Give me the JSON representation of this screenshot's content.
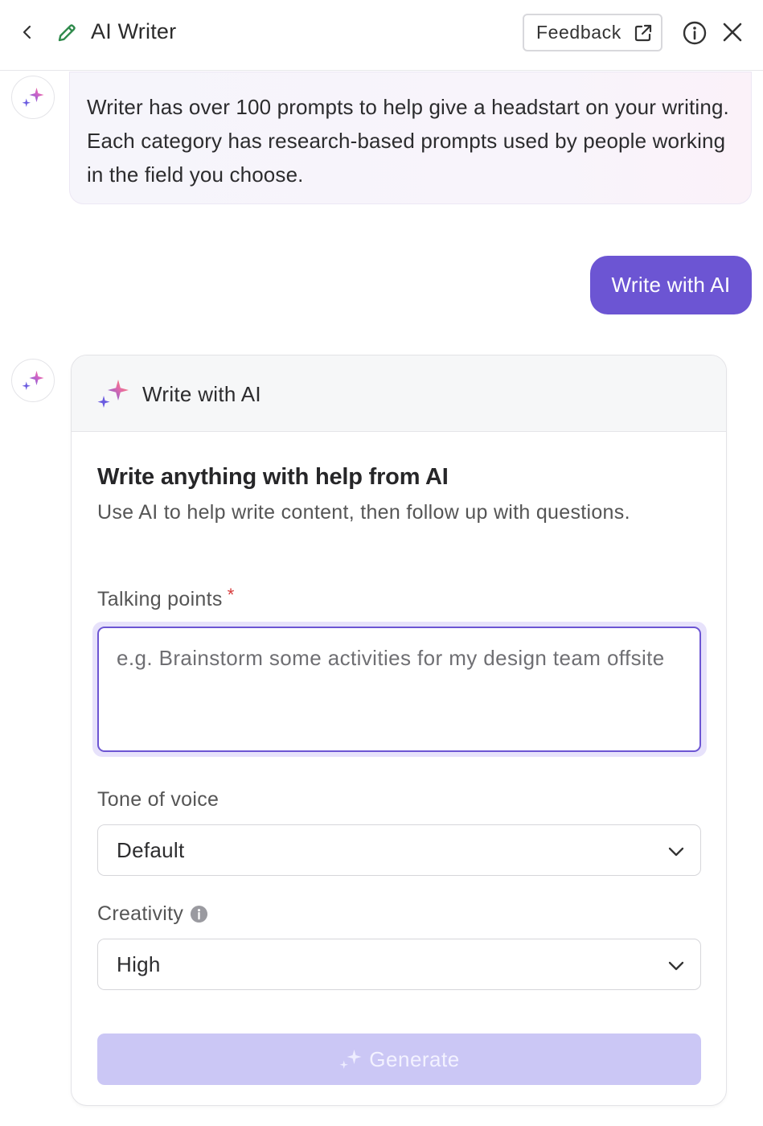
{
  "header": {
    "title": "AI Writer",
    "feedback_label": "Feedback"
  },
  "messages": {
    "intro": "Writer has over 100 prompts to help give a headstart on your writing. Each category has research-based prompts used by people working in the field you choose.",
    "user_action": "Write with AI"
  },
  "card": {
    "header_title": "Write with AI",
    "title": "Write anything with help from AI",
    "subtitle": "Use AI to help write content, then follow up with questions.",
    "talking_points": {
      "label": "Talking points",
      "required_mark": "*",
      "value": "",
      "placeholder": "e.g. Brainstorm some activities for my design team offsite"
    },
    "tone": {
      "label": "Tone of voice",
      "value": "Default"
    },
    "creativity": {
      "label": "Creativity",
      "value": "High"
    },
    "generate_label": "Generate"
  },
  "colors": {
    "accent": "#6c55d3",
    "accent_disabled": "#cbc7f5",
    "pencil_green": "#2f8a4c",
    "required_red": "#d63a3a"
  }
}
